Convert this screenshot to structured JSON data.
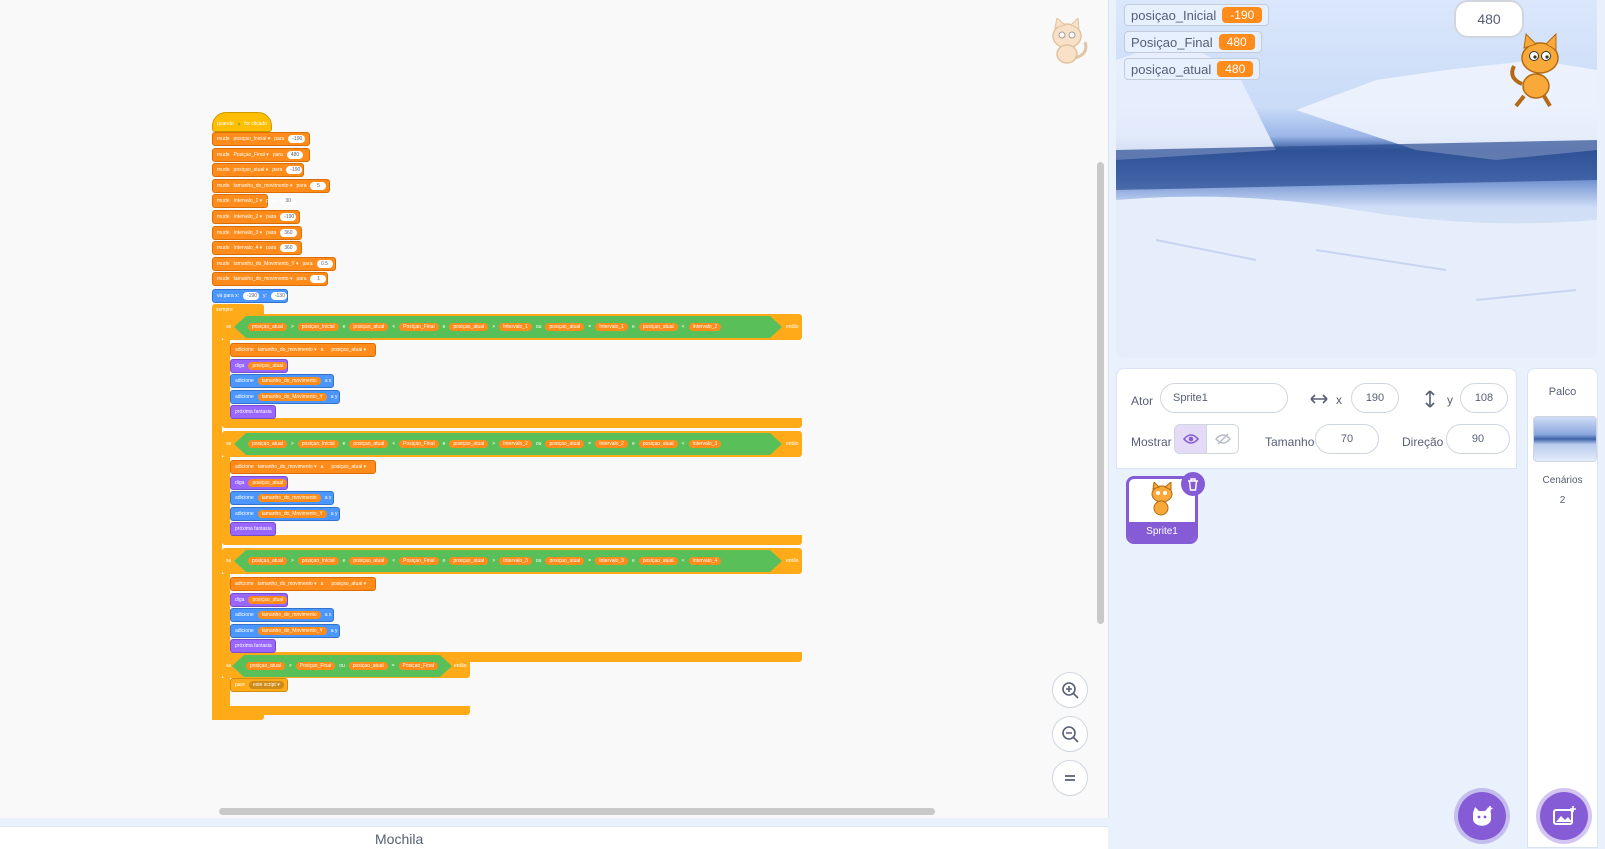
{
  "code": {
    "hat_when": "quando",
    "hat_clicked": "for clicado",
    "set_word": "mude",
    "to_word": "para",
    "set_blocks": [
      {
        "var": "posiçao_Inicial",
        "value": "-190"
      },
      {
        "var": "Posiçao_Final",
        "value": "480"
      },
      {
        "var": "posiçao_atual",
        "value": "-190"
      },
      {
        "var": "tamanho_do_movimento",
        "value": "5"
      },
      {
        "var": "Intervalo_1",
        "value": "30"
      },
      {
        "var": "Intervalo_2",
        "value": "-190"
      },
      {
        "var": "Intervalo_3",
        "value": "360"
      },
      {
        "var": "Intervalo_4",
        "value": "360"
      },
      {
        "var": "tamanho_do_Movimento_Y",
        "value": "0.5"
      },
      {
        "var": "tamanho_do_movimento",
        "value": "1"
      }
    ],
    "goto_label": "vá para x:",
    "goto_x": "-190",
    "goto_y_label": "y:",
    "goto_y": "-130",
    "forever_label": "sempre",
    "if_label": "se",
    "then_label": "então",
    "and_label": "e",
    "or_label": "ou",
    "reporters": {
      "atual": "posiçao_atual",
      "inicial": "posiçao_Inicial",
      "final": "Posiçao_Final",
      "int1": "Intervalo_1",
      "int2": "Intervalo_2",
      "int3": "Intervalo_3",
      "int4": "Intervalo_4",
      "tam": "tamanho_do_movimento",
      "tamY": "tamanho_do_Movimento_Y"
    },
    "change_label": "adicione",
    "to_label2": "a",
    "to_x_label": "a x",
    "to_y_label": "a y",
    "say_label": "diga",
    "next_costume": "próxima fantasia",
    "stop_label": "pare",
    "stop_option": "este script"
  },
  "backpack_label": "Mochila",
  "stage": {
    "monitors": [
      {
        "name": "posiçao_Inicial",
        "value": "-190"
      },
      {
        "name": "Posiçao_Final",
        "value": "480"
      },
      {
        "name": "posiçao_atual",
        "value": "480"
      }
    ],
    "speech": "480"
  },
  "sprite_info": {
    "actor_label": "Ator",
    "actor_name": "Sprite1",
    "x_label": "x",
    "x_value": "190",
    "y_label": "y",
    "y_value": "108",
    "show_label": "Mostrar",
    "size_label": "Tamanho",
    "size_value": "70",
    "direction_label": "Direção",
    "direction_value": "90"
  },
  "sprite_list": [
    {
      "name": "Sprite1"
    }
  ],
  "stage_pane": {
    "title": "Palco",
    "backdrops_label": "Cenários",
    "backdrops_count": "2"
  },
  "colors": {
    "events": "#ffbf00",
    "variables": "#ff8c1a",
    "motion": "#4c97ff",
    "looks": "#9966ff",
    "control": "#ffab19",
    "operators": "#59c059",
    "accent": "#855cd6"
  },
  "icons": [
    "green-flag-icon",
    "zoom-in-icon",
    "zoom-out-icon",
    "zoom-reset-icon",
    "eye-icon",
    "eye-off-icon",
    "trash-icon",
    "add-sprite-icon",
    "add-backdrop-icon",
    "arrows-horizontal-icon",
    "arrows-vertical-icon"
  ]
}
